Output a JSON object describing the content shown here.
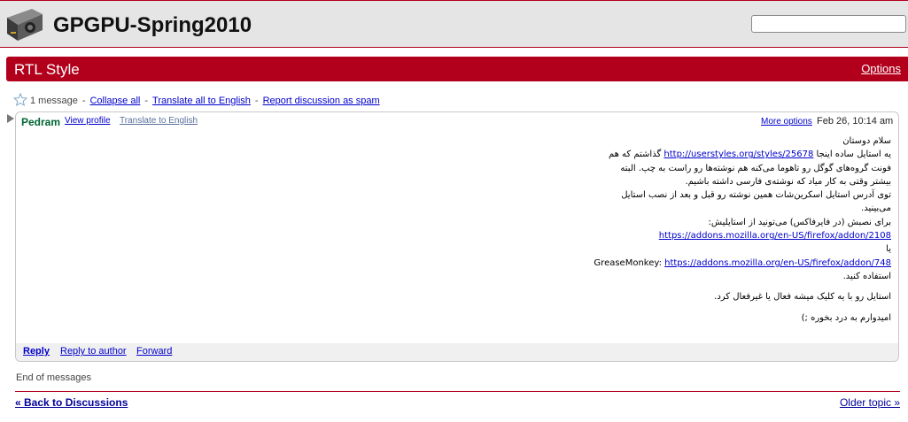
{
  "header": {
    "group_title": "GPGPU-Spring2010",
    "search_value": ""
  },
  "topic": {
    "title": "RTL Style",
    "options_label": "Options"
  },
  "actions": {
    "count": "1 message",
    "collapse_all": "Collapse all",
    "translate_all": "Translate all to English",
    "report_spam": "Report discussion as spam"
  },
  "message": {
    "author": "Pedram",
    "view_profile": "View profile",
    "translate": "Translate to English",
    "more_options": "More options",
    "date": "Feb 26, 10:14 am",
    "body": {
      "l1": "سلام دوستان",
      "l2_prefix": "یه استایل ساده اینجا ",
      "l2_link": "http://userstyles.org/styles/25678",
      "l2_suffix": " گذاشتم که هم",
      "l3": "فونت گروه‌های گوگل رو تاهوما می‌کنه هم نوشته‌ها رو راست به چپ. البته",
      "l4": "بیشتر وقتی به کار میاد که نوشته‌ی فارسی داشته باشیم.",
      "l5": "توی آدرس استایل اسکرین‌شات همین نوشته رو قبل و بعد از نصب استایل",
      "l6": "می‌بینید.",
      "l7": "برای نصبش (در فایرفاکس) می‌تونید از استایلیش:",
      "l8_link": "https://addons.mozilla.org/en-US/firefox/addon/2108",
      "l9": "یا",
      "l10_prefix": "GreaseMonkey: ",
      "l10_link": "https://addons.mozilla.org/en-US/firefox/addon/748",
      "l11": "استفاده کنید.",
      "l12": "استایل رو با یه کلیک میشه فعال یا غیرفعال کرد.",
      "l13": "امیدوارم به درد بخوره ;)"
    },
    "reply": "Reply",
    "reply_author": "Reply to author",
    "forward": "Forward"
  },
  "footer": {
    "end_text": "End of messages",
    "back_link": "« Back to Discussions",
    "older_link": "Older topic »"
  },
  "colors": {
    "accent": "#b2001c",
    "author": "#006633",
    "link": "#0000cc",
    "header_bg": "#e5e5e5"
  },
  "icons": {
    "logo": "graphics-card-icon",
    "star": "star-outline-icon",
    "arrow": "triangle-right-icon"
  }
}
